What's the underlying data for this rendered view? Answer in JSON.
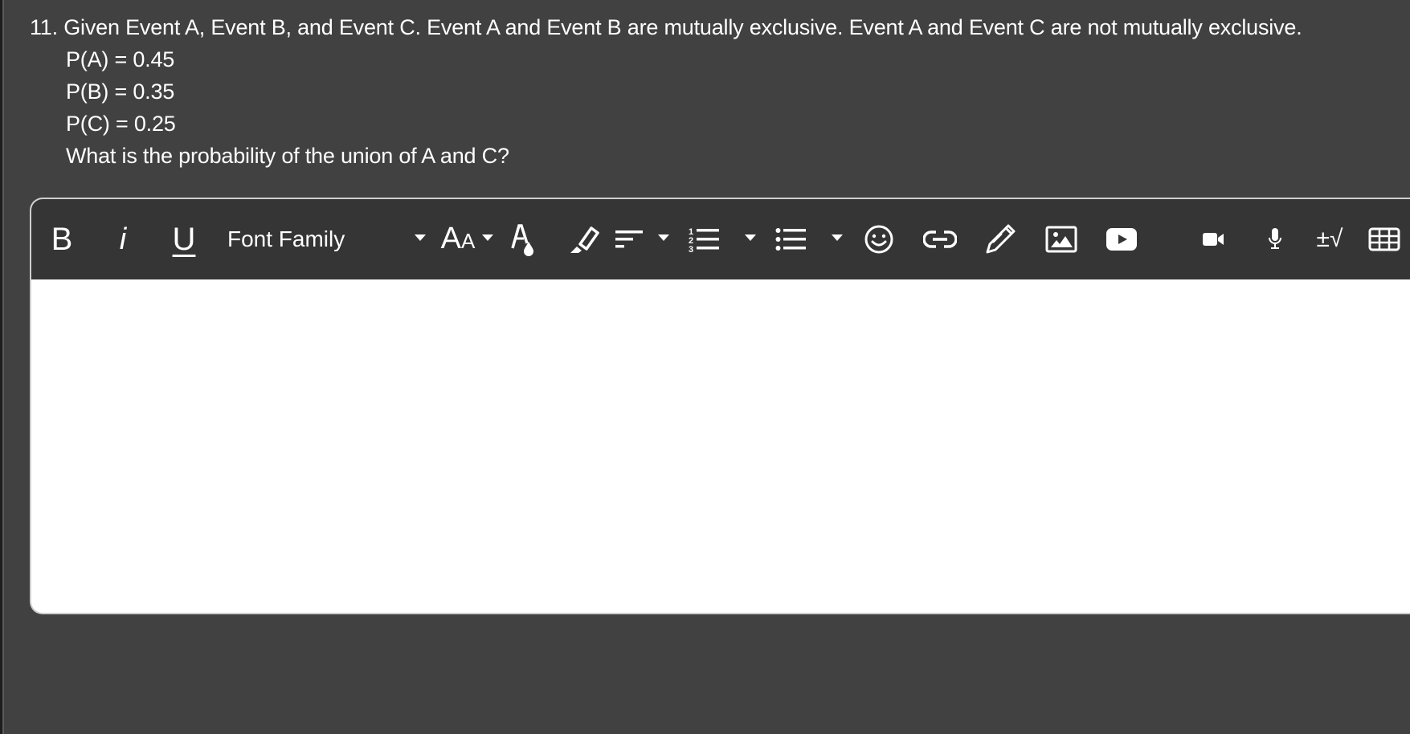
{
  "question": {
    "number": "11.",
    "lines": [
      "Given Event A, Event B, and Event C. Event A and Event B are mutually exclusive. Event A and Event C are not mutually exclusive.",
      "P(A) = 0.45",
      "P(B) = 0.35",
      "P(C) = 0.25",
      "What is the probability of the union of A and C?"
    ]
  },
  "toolbar": {
    "bold_label": "B",
    "italic_label": "i",
    "underline_label": "U",
    "font_family_label": "Font Family",
    "font_size_label": "AA",
    "math_label": "±√",
    "icons": [
      "bold-icon",
      "italic-icon",
      "underline-icon",
      "font-family-dropdown",
      "font-size-icon",
      "text-color-icon",
      "highlight-icon",
      "align-icon",
      "ordered-list-icon",
      "bullet-list-icon",
      "emoji-icon",
      "link-icon",
      "draw-icon",
      "image-icon",
      "youtube-icon",
      "video-icon",
      "microphone-icon",
      "math-equation-icon",
      "table-icon"
    ]
  },
  "editor": {
    "content": ""
  },
  "colors": {
    "page_background": "#414141",
    "toolbar_background": "#353535",
    "editor_background": "#ffffff",
    "text": "#ffffff"
  }
}
